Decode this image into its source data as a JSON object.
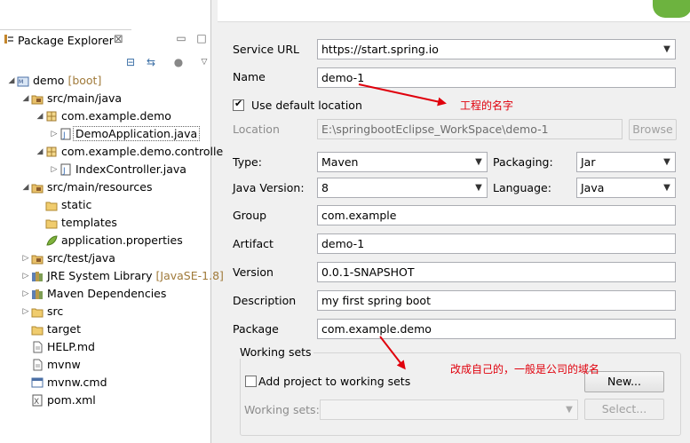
{
  "explorer": {
    "tab_label": "Package Explorer",
    "tree": [
      {
        "label": "demo",
        "tag": "[boot]",
        "icon": "project-icon",
        "twisty": "open",
        "indent": 0
      },
      {
        "label": "src/main/java",
        "icon": "source-folder-icon",
        "twisty": "open",
        "indent": 1
      },
      {
        "label": "com.example.demo",
        "icon": "package-icon",
        "twisty": "open",
        "indent": 2
      },
      {
        "label": "DemoApplication.java",
        "icon": "java-file-icon",
        "twisty": "closed",
        "indent": 3,
        "selected": true
      },
      {
        "label": "com.example.demo.controlle",
        "icon": "package-icon",
        "twisty": "open",
        "indent": 2
      },
      {
        "label": "IndexController.java",
        "icon": "java-file-icon",
        "twisty": "closed",
        "indent": 3
      },
      {
        "label": "src/main/resources",
        "icon": "source-folder-icon",
        "twisty": "open",
        "indent": 1
      },
      {
        "label": "static",
        "icon": "folder-icon",
        "twisty": "none",
        "indent": 2
      },
      {
        "label": "templates",
        "icon": "folder-icon",
        "twisty": "none",
        "indent": 2
      },
      {
        "label": "application.properties",
        "icon": "properties-file-icon",
        "twisty": "none",
        "indent": 2
      },
      {
        "label": "src/test/java",
        "icon": "source-folder-icon",
        "twisty": "closed",
        "indent": 1
      },
      {
        "label": "JRE System Library",
        "tag": "[JavaSE-1.8]",
        "icon": "library-icon",
        "twisty": "closed",
        "indent": 1
      },
      {
        "label": "Maven Dependencies",
        "icon": "library-icon",
        "twisty": "closed",
        "indent": 1
      },
      {
        "label": "src",
        "icon": "folder-icon",
        "twisty": "closed",
        "indent": 1
      },
      {
        "label": "target",
        "icon": "folder-icon",
        "twisty": "none",
        "indent": 1
      },
      {
        "label": "HELP.md",
        "icon": "file-icon",
        "twisty": "none",
        "indent": 1
      },
      {
        "label": "mvnw",
        "icon": "file-icon",
        "twisty": "none",
        "indent": 1
      },
      {
        "label": "mvnw.cmd",
        "icon": "cmd-file-icon",
        "twisty": "none",
        "indent": 1
      },
      {
        "label": "pom.xml",
        "icon": "xml-file-icon",
        "twisty": "none",
        "indent": 1
      }
    ]
  },
  "form": {
    "service_url_label": "Service URL",
    "service_url_value": "https://start.spring.io",
    "name_label": "Name",
    "name_value": "demo-1",
    "use_default_location_label": "Use default location",
    "use_default_location_checked": true,
    "location_label": "Location",
    "location_value": "E:\\springbootEclipse_WorkSpace\\demo-1",
    "browse_label": "Browse",
    "type_label": "Type:",
    "type_value": "Maven",
    "packaging_label": "Packaging:",
    "packaging_value": "Jar",
    "java_version_label": "Java Version:",
    "java_version_value": "8",
    "language_label": "Language:",
    "language_value": "Java",
    "group_label": "Group",
    "group_value": "com.example",
    "artifact_label": "Artifact",
    "artifact_value": "demo-1",
    "version_label": "Version",
    "version_value": "0.0.1-SNAPSHOT",
    "description_label": "Description",
    "description_value": "my first spring boot",
    "package_label": "Package",
    "package_value": "com.example.demo",
    "working_sets_title": "Working sets",
    "add_to_working_sets_label": "Add project to working sets",
    "add_to_working_sets_checked": false,
    "new_button_label": "New...",
    "working_sets_label": "Working sets:",
    "working_sets_value": "",
    "select_button_label": "Select..."
  },
  "annotations": {
    "name_note": "工程的名字",
    "package_note": "改成自己的，一般是公司的域名"
  },
  "colors": {
    "annotation": "#e0000c",
    "spring_green": "#6db33f"
  }
}
